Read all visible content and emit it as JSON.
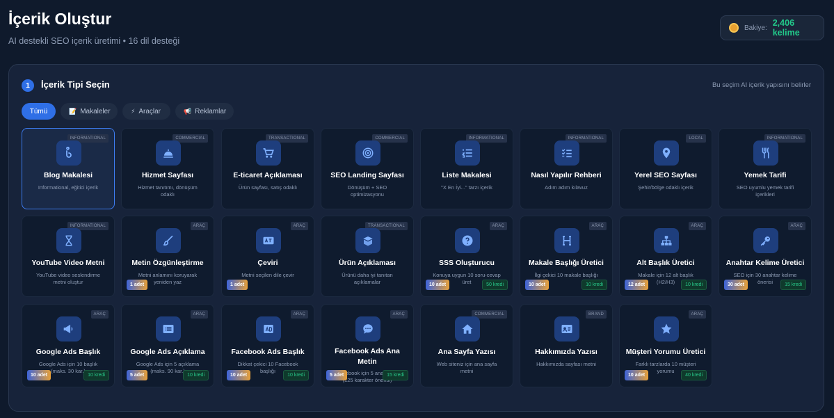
{
  "header": {
    "title": "İçerik Oluştur",
    "subtitle": "AI destekli SEO içerik üretimi • 16 dil desteği",
    "balance_label": "Bakiye:",
    "balance_value": "2,406 kelime"
  },
  "step": {
    "number": "1",
    "title": "İçerik Tipi Seçin",
    "hint": "Bu seçim AI içerik yapısını belirler"
  },
  "tabs": [
    {
      "label": "Tümü",
      "icon": ""
    },
    {
      "label": "Makaleler",
      "icon": "📝"
    },
    {
      "label": "Araçlar",
      "icon": "⚡"
    },
    {
      "label": "Reklamlar",
      "icon": "📢"
    }
  ],
  "cards": [
    {
      "title": "Blog Makalesi",
      "desc": "Informational, eğitici içerik",
      "badge": "INFORMATIONAL",
      "icon": "blog-icon"
    },
    {
      "title": "Hizmet Sayfası",
      "desc": "Hizmet tanıtımı, dönüşüm odaklı",
      "badge": "COMMERCIAL",
      "icon": "bell-service-icon"
    },
    {
      "title": "E-ticaret Açıklaması",
      "desc": "Ürün sayfası, satış odaklı",
      "badge": "TRANSACTIONAL",
      "icon": "cart-icon"
    },
    {
      "title": "SEO Landing Sayfası",
      "desc": "Dönüşüm + SEO optimizasyonu",
      "badge": "COMMERCIAL",
      "icon": "target-icon"
    },
    {
      "title": "Liste Makalesi",
      "desc": "\"X En İyi...\" tarzı içerik",
      "badge": "INFORMATIONAL",
      "icon": "numbered-list-icon"
    },
    {
      "title": "Nasıl Yapılır Rehberi",
      "desc": "Adım adım kılavuz",
      "badge": "INFORMATIONAL",
      "icon": "checklist-icon"
    },
    {
      "title": "Yerel SEO Sayfası",
      "desc": "Şehir/bölge odaklı içerik",
      "badge": "LOCAL",
      "icon": "map-pin-icon"
    },
    {
      "title": "Yemek Tarifi",
      "desc": "SEO uyumlu yemek tarifi içerikleri",
      "badge": "INFORMATIONAL",
      "icon": "utensils-icon"
    },
    {
      "title": "YouTube Video Metni",
      "desc": "YouTube video seslendirme metni oluştur",
      "badge": "INFORMATIONAL",
      "icon": "hourglass-icon"
    },
    {
      "title": "Metin Özgünleştirme",
      "desc": "Metni anlamını koruyarak yeniden yaz",
      "badge": "ARAÇ",
      "icon": "brush-icon",
      "count": "1 adet"
    },
    {
      "title": "Çeviri",
      "desc": "Metni seçilen dile çevir",
      "badge": "ARAÇ",
      "icon": "translate-icon",
      "count": "1 adet"
    },
    {
      "title": "Ürün Açıklaması",
      "desc": "Ürünü daha iyi tanıtan açıklamalar",
      "badge": "TRANSACTIONAL",
      "icon": "box-icon"
    },
    {
      "title": "SSS Oluşturucu",
      "desc": "Konuya uygun 10 soru-cevap üret",
      "badge": "ARAÇ",
      "icon": "question-icon",
      "count": "10 adet",
      "cost": "50 kredi"
    },
    {
      "title": "Makale Başlığı Üretici",
      "desc": "İlgi çekici 10 makale başlığı",
      "badge": "ARAÇ",
      "icon": "heading-icon",
      "count": "10 adet",
      "cost": "10 kredi"
    },
    {
      "title": "Alt Başlık Üretici",
      "desc": "Makale için 12 alt başlık (H2/H3)",
      "badge": "ARAÇ",
      "icon": "sitemap-icon",
      "count": "12 adet",
      "cost": "10 kredi"
    },
    {
      "title": "Anahtar Kelime Üretici",
      "desc": "SEO için 30 anahtar kelime önerisi",
      "badge": "ARAÇ",
      "icon": "key-icon",
      "count": "30 adet",
      "cost": "15 kredi"
    },
    {
      "title": "Google Ads Başlık",
      "desc": "Google Ads için 10 başlık (maks. 30 kar.)",
      "badge": "ARAÇ",
      "icon": "megaphone-icon",
      "count": "10 adet",
      "cost": "10 kredi"
    },
    {
      "title": "Google Ads Açıklama",
      "desc": "Google Ads için 5 açıklama (maks. 90 kar.)",
      "badge": "ARAÇ",
      "icon": "list-alt-icon",
      "count": "5 adet",
      "cost": "10 kredi"
    },
    {
      "title": "Facebook Ads Başlık",
      "desc": "Dikkat çekici 10 Facebook başlığı",
      "badge": "ARAÇ",
      "icon": "ad-icon",
      "count": "10 adet",
      "cost": "10 kredi"
    },
    {
      "title": "Facebook Ads Ana Metin",
      "desc": "Facebook için 5 ana metin (125 karakter önerisi)",
      "badge": "ARAÇ",
      "icon": "chat-icon",
      "count": "5 adet",
      "cost": "15 kredi"
    },
    {
      "title": "Ana Sayfa Yazısı",
      "desc": "Web siteniz için ana sayfa metni",
      "badge": "COMMERCIAL",
      "icon": "home-icon"
    },
    {
      "title": "Hakkımızda Yazısı",
      "desc": "Hakkımızda sayfası metni",
      "badge": "BRAND",
      "icon": "id-card-icon"
    },
    {
      "title": "Müşteri Yorumu Üretici",
      "desc": "Farklı tarzlarda 10 müşteri yorumu",
      "badge": "ARAÇ",
      "icon": "star-icon",
      "count": "10 adet",
      "cost": "40 kredi"
    }
  ],
  "colors": {
    "background": "#0f1a2c",
    "accent": "#2f6fe6",
    "credit_green": "#22c98a"
  }
}
